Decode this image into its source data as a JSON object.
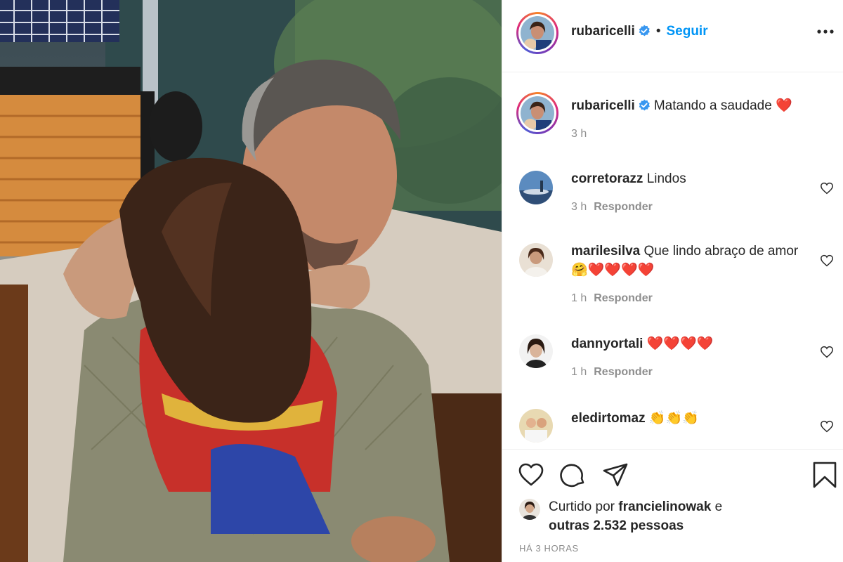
{
  "post": {
    "author": "rubaricelli",
    "separator": "•",
    "follow_label": "Seguir",
    "caption": "Matando a saudade",
    "caption_emoji": "❤️",
    "caption_time": "3 h"
  },
  "comments": [
    {
      "user": "corretorazz",
      "text": "Lindos",
      "time": "3 h",
      "reply_label": "Responder"
    },
    {
      "user": "marilesilva",
      "text": "Que lindo abraço de amor",
      "emoji": "🤗❤️❤️❤️❤️",
      "time": "1 h",
      "reply_label": "Responder"
    },
    {
      "user": "dannyortali",
      "text": "",
      "emoji": "❤️❤️❤️❤️",
      "time": "1 h",
      "reply_label": "Responder"
    },
    {
      "user": "eledirtomaz",
      "text": "",
      "emoji": "👏👏👏",
      "time": "",
      "reply_label": ""
    }
  ],
  "likes": {
    "prefix": "Curtido por",
    "user": "francielinowak",
    "conj": "e",
    "others": "outras 2.532 pessoas"
  },
  "timestamp": "HÁ 3 HORAS",
  "icons": {
    "like": "heart-outline-icon",
    "comment": "comment-bubble-icon",
    "share": "paper-plane-icon",
    "save": "bookmark-icon",
    "more": "ellipsis-icon",
    "verified": "verified-badge-icon"
  },
  "colors": {
    "accent": "#0095f6",
    "verified": "#3897f0",
    "muted": "#8e8e8e",
    "text": "#262626"
  }
}
